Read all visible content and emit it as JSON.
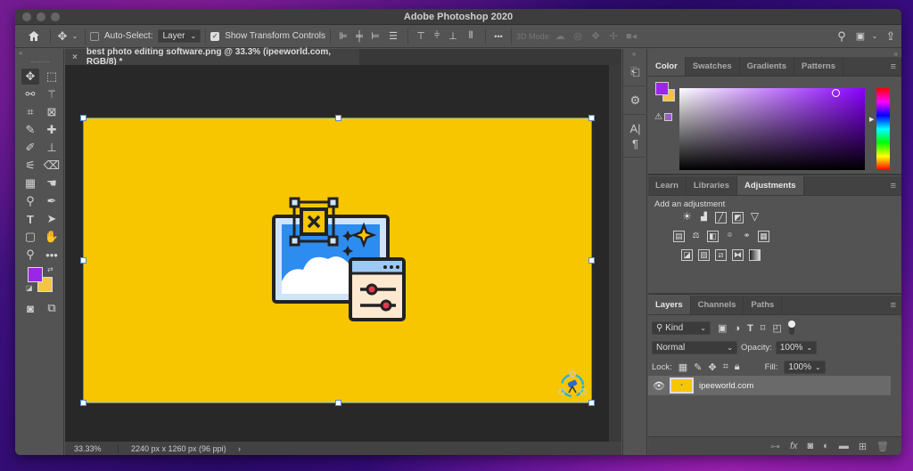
{
  "app": {
    "title": "Adobe Photoshop 2020"
  },
  "options_bar": {
    "home_icon": "home-icon",
    "move_tool_icon": "move-icon",
    "auto_select_label": "Auto-Select:",
    "auto_select_checked": false,
    "auto_select_value": "Layer",
    "show_transform_label": "Show Transform Controls",
    "show_transform_checked": true,
    "more_label": "•••",
    "mode_3d_label": "3D Mode:",
    "search_icon": "search-icon",
    "workspace_icon": "workspace-icon",
    "share_icon": "share-icon"
  },
  "document": {
    "tab_title": "best photo editing software.png @ 33.3% (ipeeworld.com, RGB/8) *",
    "close_label": "×",
    "image_bg_color": "#f7c600"
  },
  "status": {
    "zoom": "33.33%",
    "dimensions": "2240 px x 1260 px (96 ppi)",
    "arrow": "›"
  },
  "tools": {
    "foreground_color": "#9b27e6",
    "background_color": "#f5c542"
  },
  "color_panel": {
    "tabs": [
      "Color",
      "Swatches",
      "Gradients",
      "Patterns"
    ],
    "active_tab": "Color",
    "fg_color": "#9b27e6",
    "bg_color": "#f5c542",
    "hue_color": "#8a00ff",
    "web_safe_color": "#9b5cc8"
  },
  "adjustments_panel": {
    "tabs": [
      "Learn",
      "Libraries",
      "Adjustments"
    ],
    "active_tab": "Adjustments",
    "heading": "Add an adjustment"
  },
  "layers_panel": {
    "tabs": [
      "Layers",
      "Channels",
      "Paths"
    ],
    "active_tab": "Layers",
    "filter_label": "Kind",
    "blend_mode": "Normal",
    "opacity_label": "Opacity:",
    "opacity_value": "100%",
    "lock_label": "Lock:",
    "fill_label": "Fill:",
    "fill_value": "100%",
    "layers": [
      {
        "name": "ipeeworld.com",
        "visible": true
      }
    ],
    "footer_icons": [
      "link-icon",
      "fx-icon",
      "mask-icon",
      "adjustment-layer-icon",
      "folder-icon",
      "new-layer-icon",
      "trash-icon"
    ]
  }
}
